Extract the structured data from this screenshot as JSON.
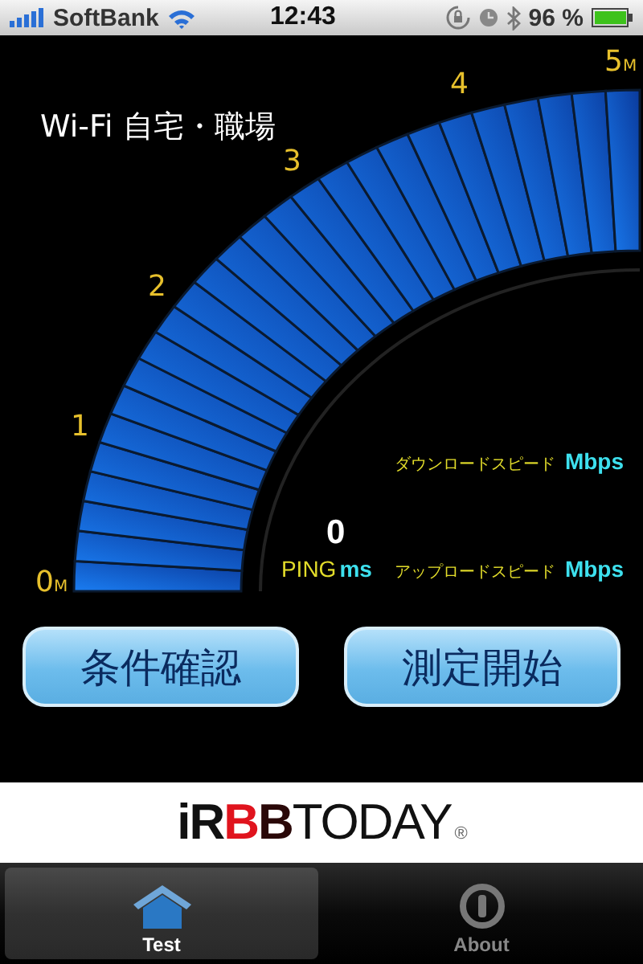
{
  "status_bar": {
    "carrier": "SoftBank",
    "time": "12:43",
    "battery": "96 %"
  },
  "title": "Wi-Fi 自宅・職場",
  "gauge": {
    "ticks": [
      "0$_{M}$",
      "1",
      "2",
      "3",
      "4",
      "5$_{M}$"
    ]
  },
  "readings": {
    "ping_value": "0",
    "ping_label": "PING",
    "ping_unit": "ms",
    "download_label": "ダウンロードスピード",
    "download_unit": "Mbps",
    "upload_label": "アップロードスピード",
    "upload_unit": "Mbps"
  },
  "buttons": [
    "条件確認",
    "測定開始"
  ],
  "banner": {
    "logo_parts": [
      {
        "text": "iR",
        "color": "#111111"
      },
      {
        "text": "B",
        "color": "#e0141e"
      },
      {
        "text": "B",
        "color": "#2a0808"
      },
      {
        "text": "TODAY",
        "color": "#111111"
      },
      {
        "text": "®",
        "color": "#666666"
      }
    ]
  },
  "tabs": [
    {
      "label": "Test",
      "kind": "home",
      "selected": true
    },
    {
      "label": "About",
      "kind": "info",
      "selected": false
    }
  ]
}
